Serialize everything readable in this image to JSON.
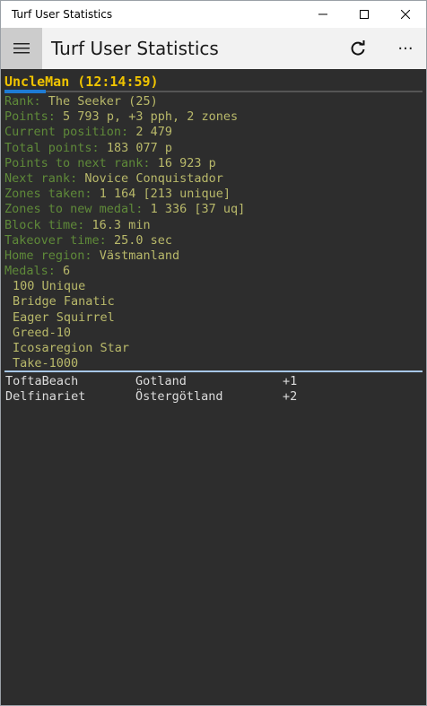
{
  "window": {
    "title": "Turf User Statistics"
  },
  "appbar": {
    "title": "Turf User Statistics",
    "more_label": "···"
  },
  "user": {
    "header": "UncleMan (12:14:59)"
  },
  "stats": [
    {
      "label": "Rank:",
      "value": "The Seeker (25)"
    },
    {
      "label": "Points:",
      "value": "5 793 p, +3 pph, 2 zones"
    },
    {
      "label": "Current position:",
      "value": "2 479"
    },
    {
      "label": "Total points:",
      "value": "183 077 p"
    },
    {
      "label": "Points to next rank:",
      "value": "16 923 p"
    },
    {
      "label": "Next rank:",
      "value": "Novice Conquistador"
    },
    {
      "label": "Zones taken:",
      "value": "1 164 [213 unique]"
    },
    {
      "label": "Zones to new medal:",
      "value": "1 336 [37 uq]"
    },
    {
      "label": "Block time:",
      "value": "16.3 min"
    },
    {
      "label": "Takeover time:",
      "value": "25.0 sec"
    },
    {
      "label": "Home region:",
      "value": "Västmanland"
    },
    {
      "label": "Medals:",
      "value": "6"
    }
  ],
  "medals": [
    "100 Unique",
    "Bridge Fanatic",
    "Eager Squirrel",
    "Greed-10",
    "Icosaregion Star",
    "Take-1000"
  ],
  "zones": [
    {
      "name": "ToftaBeach",
      "region": "Gotland",
      "pph": "+1"
    },
    {
      "name": "Delfinariet",
      "region": "Östergötland",
      "pph": "+2"
    }
  ],
  "colors": {
    "header": "#f0c400",
    "label": "#5f8a39",
    "value": "#b9b96a",
    "accent": "#1e7bd4",
    "separator": "#a7c7e7"
  },
  "icons": {
    "menu": "hamburger-icon",
    "refresh": "refresh-icon",
    "more": "more-icon"
  }
}
